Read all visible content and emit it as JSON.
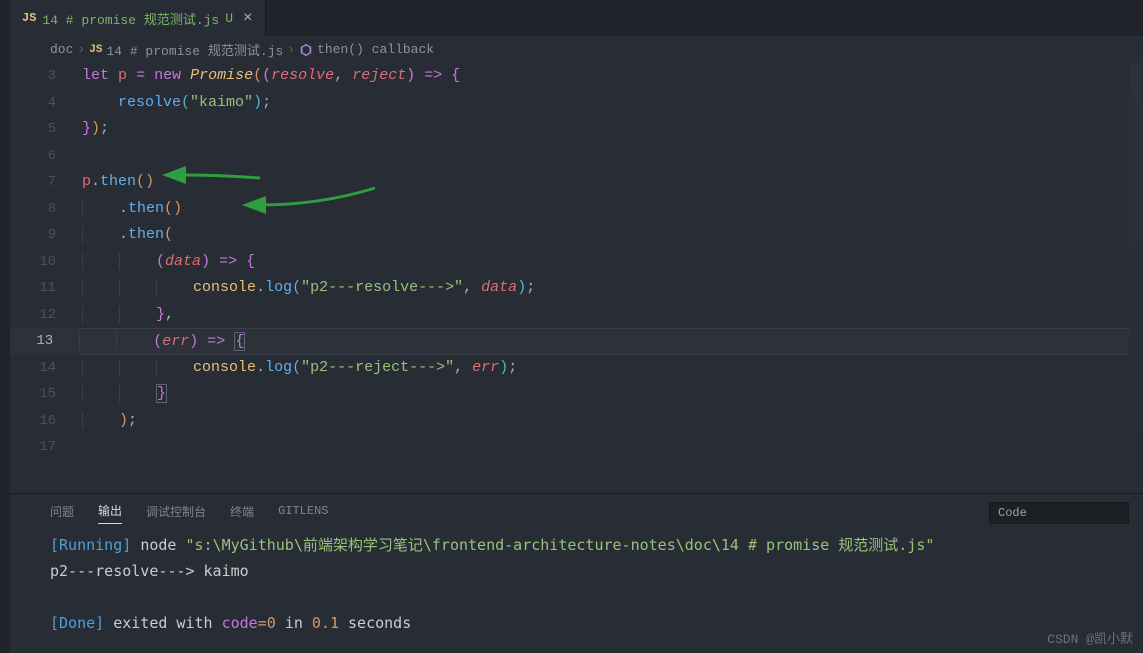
{
  "tab": {
    "icon": "JS",
    "name": "14 # promise 规范测试.js",
    "modified": "U",
    "close": "×"
  },
  "breadcrumb": {
    "seg1": "doc",
    "icon": "JS",
    "seg2": "14 # promise 规范测试.js",
    "sym": "then() callback"
  },
  "lines": {
    "l3": {
      "num": "3"
    },
    "l4": {
      "num": "4"
    },
    "l5": {
      "num": "5"
    },
    "l6": {
      "num": "6"
    },
    "l7": {
      "num": "7"
    },
    "l8": {
      "num": "8"
    },
    "l9": {
      "num": "9"
    },
    "l10": {
      "num": "10"
    },
    "l11": {
      "num": "11"
    },
    "l12": {
      "num": "12"
    },
    "l13": {
      "num": "13"
    },
    "l14": {
      "num": "14"
    },
    "l15": {
      "num": "15"
    },
    "l16": {
      "num": "16"
    },
    "l17": {
      "num": "17"
    }
  },
  "tokens": {
    "let": "let",
    "p": "p",
    "eq": "=",
    "new": "new",
    "Promise": "Promise",
    "resolve": "resolve",
    "reject": "reject",
    "arrow": "=>",
    "kaimo": "\"kaimo\"",
    "then": "then",
    "data": "data",
    "console": "console",
    "log": "log",
    "str1": "\"p2---resolve--->\"",
    "err": "err",
    "str2": "\"p2---reject--->\"",
    "comma": ",",
    "dot": ".",
    "semi": ";",
    "po": "(",
    "pc": ")",
    "bo": "{",
    "bc": "}"
  },
  "panel": {
    "tabs": {
      "problems": "问题",
      "output": "输出",
      "debug": "调试控制台",
      "terminal": "终端",
      "gitlens": "GITLENS"
    },
    "channel": "Code",
    "out": {
      "running": "[Running]",
      "node": "node",
      "path": "\"s:\\MyGithub\\前端架构学习笔记\\frontend-architecture-notes\\doc\\14 # promise 规范测试.js\"",
      "line2": "p2---resolve---> kaimo",
      "done": "[Done]",
      "exited": "exited with",
      "codekw": "code",
      "codeval": "=0",
      "inword": "in",
      "time": "0.1",
      "sec": "seconds"
    }
  },
  "watermark": "CSDN @凯小默"
}
